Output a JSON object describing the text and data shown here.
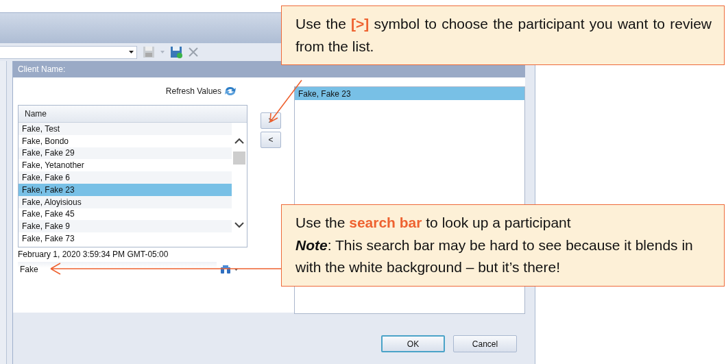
{
  "panel": {
    "title": "Client Name:",
    "refresh_label": "Refresh Values",
    "available_list": {
      "column": "Name",
      "rows": [
        {
          "name": "Fake, Test",
          "selected": false
        },
        {
          "name": "Fake, Bondo",
          "selected": false
        },
        {
          "name": "Fake, Fake 29",
          "selected": false
        },
        {
          "name": "Fake, Yetanother",
          "selected": false
        },
        {
          "name": "Fake, Fake 6",
          "selected": false
        },
        {
          "name": "Fake, Fake 23",
          "selected": true
        },
        {
          "name": "Fake, Aloyisious",
          "selected": false
        },
        {
          "name": "Fake, Fake 45",
          "selected": false
        },
        {
          "name": "Fake, Fake 9",
          "selected": false
        },
        {
          "name": "Fake, Fake 73",
          "selected": false
        }
      ]
    },
    "move_buttons": [
      ">",
      "<"
    ],
    "selected_list": {
      "rows": [
        {
          "name": "Fake, Fake 23",
          "selected": true
        }
      ]
    },
    "timestamp": "February 1, 2020 3:59:34 PM GMT-05:00",
    "search": {
      "value": "Fake"
    }
  },
  "buttons": [
    {
      "label": "OK",
      "focused": true
    },
    {
      "label": "Cancel",
      "focused": false
    }
  ],
  "callouts": [
    {
      "lines": [
        {
          "kind": "lead",
          "text": "Use the **[>]** symbol to choose the participant you want to review from the list."
        }
      ]
    },
    {
      "lines": [
        {
          "kind": "lead",
          "text": "Use the **search bar** to look up a participant"
        },
        {
          "kind": "note",
          "text": "**Note**: This search bar may be hard to see because it blends in with the white background – but it’s there!"
        }
      ]
    }
  ]
}
